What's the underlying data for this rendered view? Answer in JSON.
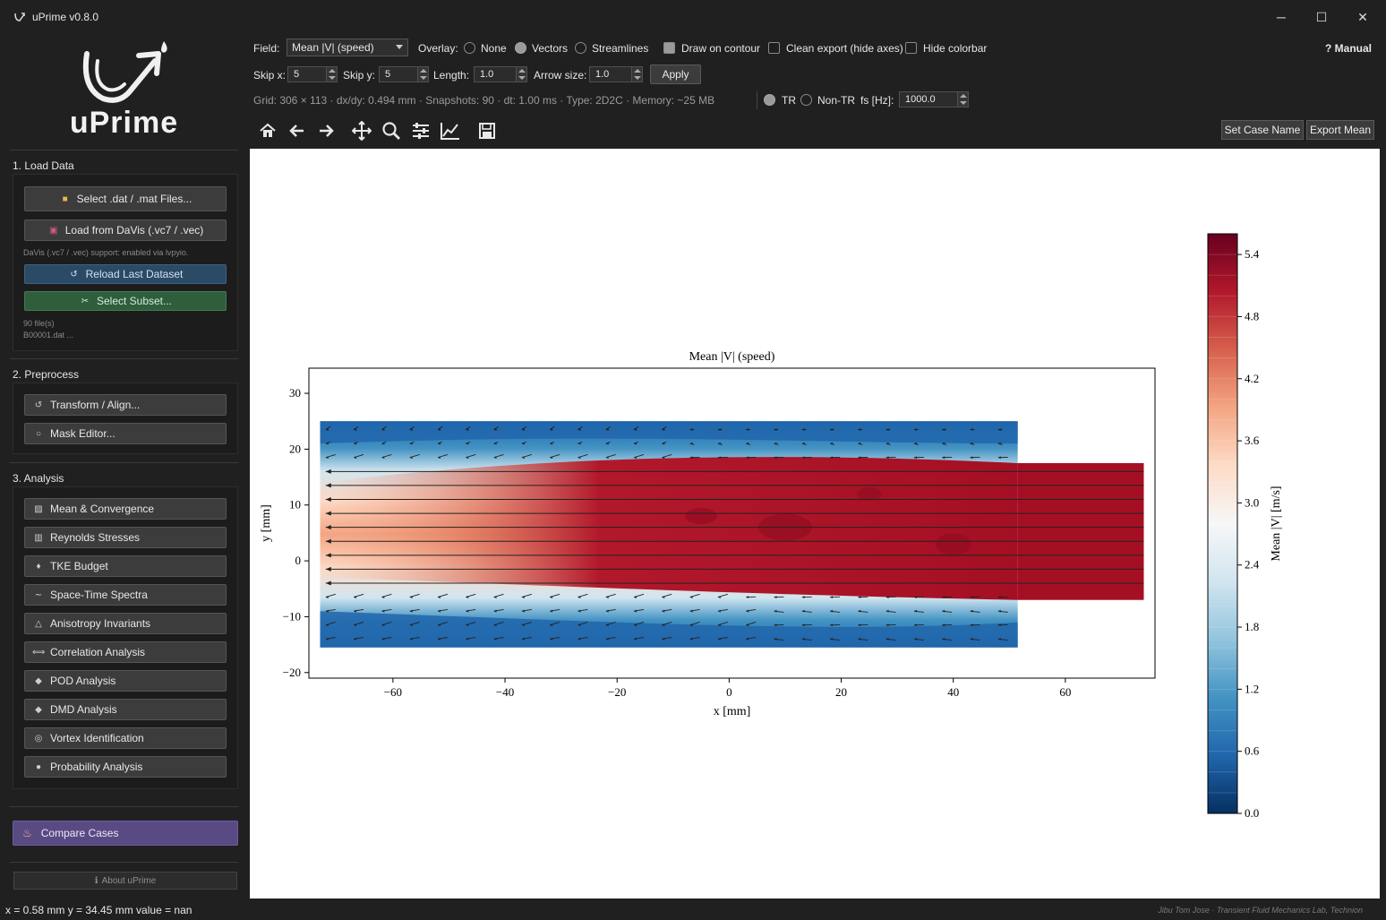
{
  "window": {
    "title": "uPrime v0.8.0",
    "controls": {
      "minimize": "─",
      "maximize": "☐",
      "close": "✕"
    }
  },
  "logo": {
    "text": "uPrime"
  },
  "sidebar": {
    "load": {
      "title": "1. Load Data",
      "select_files": "Select .dat / .mat Files...",
      "load_davis": "Load from DaVis (.vc7 / .vec)",
      "davis_note": "DaVis (.vc7 / .vec) support: enabled via lvpyio.",
      "reload": "Reload Last Dataset",
      "subset": "Select Subset...",
      "file_count": "90 file(s)",
      "file_name": "B00001.dat ..."
    },
    "preprocess": {
      "title": "2. Preprocess",
      "transform": "Transform / Align...",
      "mask": "Mask Editor..."
    },
    "analysis": {
      "title": "3. Analysis",
      "items": [
        {
          "label": "Mean & Convergence",
          "icon": "chart-icon"
        },
        {
          "label": "Reynolds Stresses",
          "icon": "bar-chart-icon"
        },
        {
          "label": "TKE Budget",
          "icon": "flame-icon"
        },
        {
          "label": "Space-Time Spectra",
          "icon": "wave-icon"
        },
        {
          "label": "Anisotropy Invariants",
          "icon": "triangle-icon"
        },
        {
          "label": "Correlation Analysis",
          "icon": "arrows-icon"
        },
        {
          "label": "POD Analysis",
          "icon": "diamond-icon"
        },
        {
          "label": "DMD Analysis",
          "icon": "diamond-icon"
        },
        {
          "label": "Vortex Identification",
          "icon": "vortex-icon"
        },
        {
          "label": "Probability Analysis",
          "icon": "dot-icon"
        }
      ]
    },
    "compare": "Compare Cases",
    "about": "About uPrime"
  },
  "toolbar": {
    "field_label": "Field:",
    "field_value": "Mean |V| (speed)",
    "overlay_label": "Overlay:",
    "overlay_options": [
      "None",
      "Vectors",
      "Streamlines"
    ],
    "overlay_selected": "Vectors",
    "draw_on_contour": "Draw on contour",
    "clean_export": "Clean export (hide axes)",
    "hide_colorbar": "Hide colorbar",
    "manual": "? Manual",
    "skip_x_label": "Skip x:",
    "skip_x": "5",
    "skip_y_label": "Skip y:",
    "skip_y": "5",
    "length_label": "Length:",
    "length": "1.0",
    "arrow_size_label": "Arrow size:",
    "arrow_size": "1.0",
    "apply": "Apply",
    "info": "Grid: 306 × 113 · dx/dy: 0.494 mm · Snapshots: 90 · dt: 1.00 ms · Type: 2D2C · Memory: ~25 MB",
    "tr": "TR",
    "non_tr": "Non-TR",
    "fs_label": "fs [Hz]:",
    "fs_value": "1000.0",
    "set_case_name": "Set Case Name",
    "export_mean": "Export Mean"
  },
  "chart_data": {
    "type": "heatmap",
    "title": "Mean |V| (speed)",
    "xlabel": "x [mm]",
    "ylabel": "y [mm]",
    "xlim": [
      -75,
      76
    ],
    "ylim": [
      -21,
      34.5
    ],
    "xticks": [
      -60,
      -40,
      -20,
      0,
      20,
      40,
      60
    ],
    "yticks": [
      -20,
      -10,
      0,
      10,
      20,
      30
    ],
    "colorbar": {
      "label": "Mean |V| [m/s]",
      "range": [
        0.0,
        5.6
      ],
      "ticks": [
        0.0,
        0.6,
        1.2,
        1.8,
        2.4,
        3.0,
        3.6,
        4.2,
        4.8,
        5.4
      ],
      "colormap": "RdBu_r"
    },
    "regions": {
      "outer_domain": {
        "x": [
          -73,
          51.5
        ],
        "y": [
          -15.5,
          25
        ]
      },
      "jet_extension": {
        "x": [
          51.5,
          74
        ],
        "y": [
          -7,
          17.5
        ]
      },
      "jet_core_speed": 5.4,
      "ambient_speed": 0.3
    },
    "overlay": "vectors"
  },
  "status": {
    "coords": "x = 0.58 mm  y = 34.45 mm  value = nan",
    "credit": "Jibu Tom Jose  ·  Transient Fluid Mechanics Lab, Technion"
  }
}
